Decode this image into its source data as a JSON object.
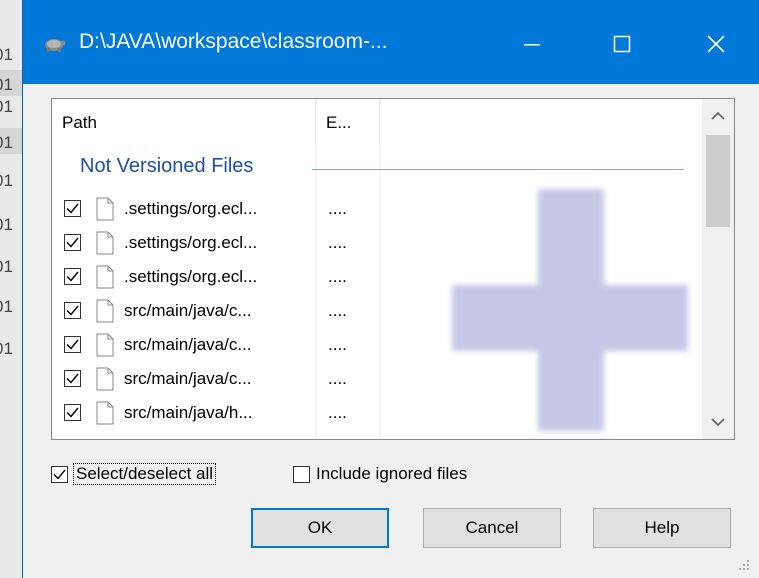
{
  "background": {
    "row_fragments": [
      "01",
      "01",
      "01",
      "01",
      "01",
      "01",
      "01",
      "01",
      "01"
    ]
  },
  "titlebar": {
    "title": "D:\\JAVA\\workspace\\classroom-...",
    "app_icon": "tortoise-icon",
    "minimize_icon": "minimize-icon",
    "maximize_icon": "maximize-icon",
    "close_icon": "close-icon",
    "accent": "#0078d7"
  },
  "list": {
    "columns": [
      {
        "label": "Path"
      },
      {
        "label": "E..."
      }
    ],
    "group_header": "Not Versioned Files",
    "rows": [
      {
        "checked": true,
        "name": ".settings/org.ecl...",
        "ext": "...."
      },
      {
        "checked": true,
        "name": ".settings/org.ecl...",
        "ext": "...."
      },
      {
        "checked": true,
        "name": ".settings/org.ecl...",
        "ext": "...."
      },
      {
        "checked": true,
        "name": "src/main/java/c...",
        "ext": "...."
      },
      {
        "checked": true,
        "name": "src/main/java/c...",
        "ext": "...."
      },
      {
        "checked": true,
        "name": "src/main/java/c...",
        "ext": "...."
      },
      {
        "checked": true,
        "name": "src/main/java/h...",
        "ext": "...."
      }
    ],
    "watermark_icon": "plus-icon"
  },
  "options": {
    "select_all": {
      "label": "Select/deselect all",
      "checked": true
    },
    "include_ignored": {
      "label": "Include ignored files",
      "checked": false
    }
  },
  "buttons": {
    "ok": "OK",
    "cancel": "Cancel",
    "help": "Help"
  }
}
